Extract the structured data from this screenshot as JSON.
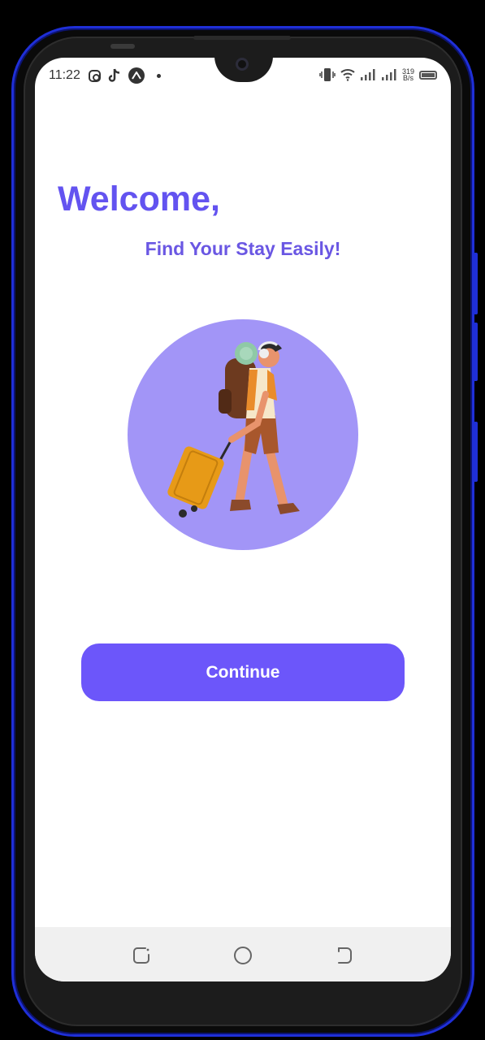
{
  "status_bar": {
    "time": "11:22",
    "left_icons": [
      "instagram-icon",
      "tiktok-icon",
      "circle-a-icon",
      "dot-icon"
    ],
    "right_icons": [
      "vibrate-icon",
      "wifi-icon",
      "signal-icon",
      "signal-icon",
      "battery-icon"
    ],
    "net_speed_value": "319",
    "net_speed_unit": "B/s"
  },
  "welcome": {
    "title": "Welcome,",
    "subtitle": "Find Your Stay Easily!"
  },
  "illustration": {
    "icon": "traveler-with-suitcase-illustration",
    "circle_color": "#a295f7"
  },
  "continue_button": {
    "label": "Continue",
    "color": "#6c56fa"
  },
  "nav_bar": {
    "buttons": [
      "recents-icon",
      "home-icon",
      "back-icon"
    ]
  },
  "colors": {
    "accent": "#6353f0",
    "device_frame": "#1f2fd8"
  }
}
